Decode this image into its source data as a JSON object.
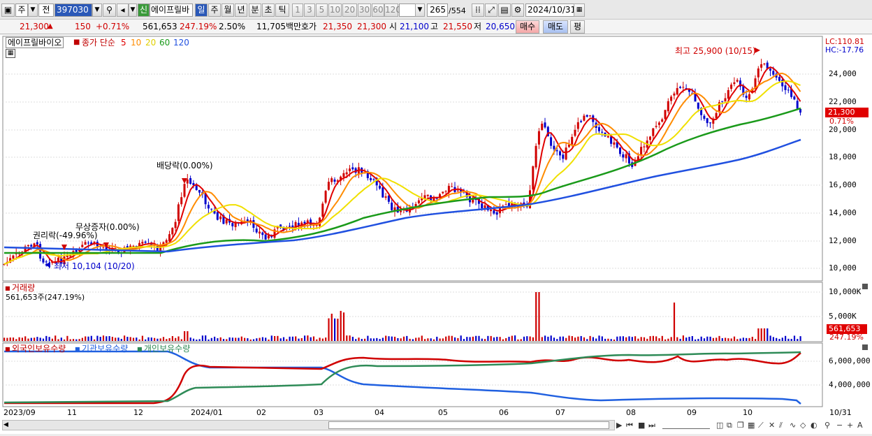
{
  "toolbar": {
    "mode1": "주",
    "mode2": "전",
    "code": "397030",
    "shin": "신",
    "name": "에이프릴바",
    "periods": [
      "일",
      "주",
      "월",
      "년",
      "분",
      "초",
      "틱"
    ],
    "nums": [
      "1",
      "3",
      "5",
      "10",
      "20",
      "30",
      "60",
      "120"
    ],
    "count": "265",
    "total": "/554",
    "date": "2024/10/31"
  },
  "quote": {
    "price": "21,300",
    "arrow": "▲",
    "change": "150",
    "rate": "+0.71%",
    "volume": "561,653",
    "vol_rate": "247.19%",
    "turn": "2.50%",
    "amount": "11,705백만",
    "ask_label": "호가",
    "ask1": "21,350",
    "ask2": "21,300",
    "open_label": "시",
    "open": "21,100",
    "high_label": "고",
    "high": "21,550",
    "low_label": "저",
    "low": "20,650",
    "buy": "매수",
    "sell": "매도",
    "avg": "평"
  },
  "price_panel": {
    "name": "에이프릴바이오",
    "ma_label": "종가 단순",
    "ma_periods": [
      "5",
      "10",
      "20",
      "60",
      "120"
    ],
    "lc": "LC:110.81",
    "hc": "HC:-17.76",
    "max_label": "최고 25,900 (10/15)",
    "min_label": "최저 10,104 (10/20)",
    "ann_dividend": "배당락(0.00%)",
    "ann_free": "무상증자(0.00%)",
    "ann_rights": "권리락(-49.96%)",
    "last_price": "21,300",
    "last_rate": "0.71%",
    "yticks": [
      "24,000",
      "22,000",
      "20,000",
      "18,000",
      "16,000",
      "14,000",
      "12,000",
      "10,000"
    ]
  },
  "volume_panel": {
    "title": "거래량",
    "value": "561,653주(247.19%)",
    "yticks": [
      "10,000K",
      "5,000K"
    ],
    "last": "561,653",
    "last_rate": "247.19%"
  },
  "holding_panel": {
    "foreign": "외국인보유수량",
    "inst": "기관보유수량",
    "person": "개인보유수량",
    "yticks": [
      "6,000,000",
      "4,000,000"
    ]
  },
  "xaxis": {
    "months": [
      "2023/09",
      "11",
      "12",
      "2024/01",
      "02",
      "03",
      "04",
      "05",
      "06",
      "07",
      "08",
      "09",
      "10",
      "10/31"
    ]
  },
  "colors": {
    "up": "#d00000",
    "down": "#0000cc",
    "ma5": "#e00000",
    "ma10": "#ff8c00",
    "ma20": "#f0e000",
    "ma60": "#1a9a1a",
    "ma120": "#2050e0",
    "foreign": "#d00000",
    "inst": "#2060e0",
    "person": "#2e8b57"
  },
  "icons": [
    "chart-window-icon",
    "scroll-left-icon",
    "scroll-right-icon",
    "nav-first-icon",
    "stop-icon",
    "nav-last-icon",
    "zoom-icon",
    "zoom-out-icon",
    "zoom-in-icon",
    "text-tool-icon",
    "settings-icon",
    "save-icon",
    "tools-icon",
    "grid-icon"
  ]
}
